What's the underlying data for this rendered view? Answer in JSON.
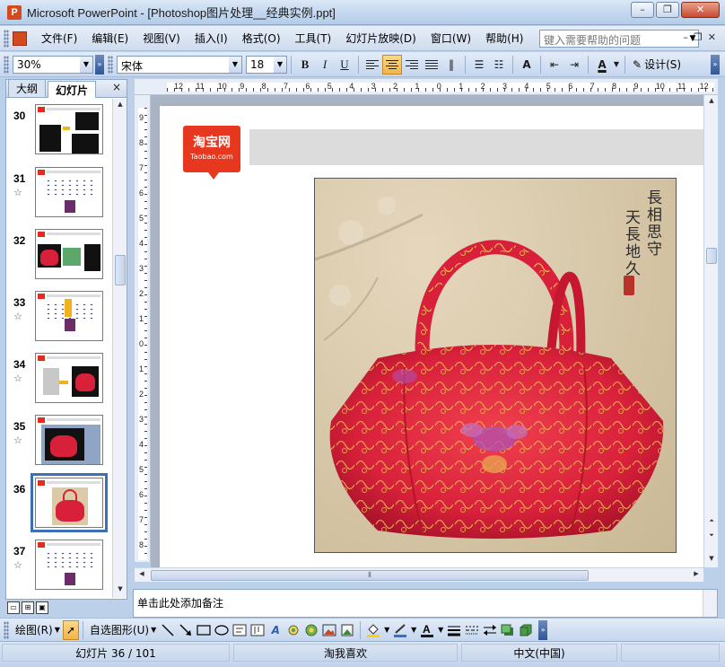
{
  "window": {
    "title": "Microsoft PowerPoint - [Photoshop图片处理__经典实例.ppt]",
    "app_icon_letter": "P",
    "minimize": "–",
    "restore": "❐",
    "close": "✕"
  },
  "menu": {
    "items": [
      "文件(F)",
      "编辑(E)",
      "视图(V)",
      "插入(I)",
      "格式(O)",
      "工具(T)",
      "幻灯片放映(D)",
      "窗口(W)",
      "帮助(H)"
    ],
    "help_placeholder": "键入需要帮助的问题",
    "mdi_minimize": "–",
    "mdi_restore": "❐",
    "mdi_close": "✕"
  },
  "format_toolbar": {
    "zoom": "30%",
    "font": "宋体",
    "size": "18",
    "bold": "B",
    "italic": "I",
    "underline": "U",
    "grow_font": "A",
    "font_color": "A",
    "design": "设计(S)"
  },
  "outline_pane": {
    "tabs": [
      "大纲",
      "幻灯片"
    ],
    "active_tab": "幻灯片",
    "close": "×",
    "slides": [
      {
        "number": "30",
        "star": ""
      },
      {
        "number": "31",
        "star": "☆"
      },
      {
        "number": "32",
        "star": ""
      },
      {
        "number": "33",
        "star": "☆"
      },
      {
        "number": "34",
        "star": "☆"
      },
      {
        "number": "35",
        "star": "☆"
      },
      {
        "number": "36",
        "star": "",
        "selected": true
      },
      {
        "number": "37",
        "star": "☆"
      }
    ]
  },
  "rulers": {
    "horizontal": [
      "12",
      "11",
      "10",
      "9",
      "8",
      "7",
      "6",
      "5",
      "4",
      "3",
      "2",
      "1",
      "0",
      "1",
      "2",
      "3",
      "4",
      "5",
      "6",
      "7",
      "8",
      "9",
      "10",
      "11",
      "12"
    ],
    "vertical": [
      "9",
      "8",
      "7",
      "6",
      "5",
      "4",
      "3",
      "2",
      "1",
      "0",
      "1",
      "2",
      "3",
      "4",
      "5",
      "6",
      "7",
      "8"
    ]
  },
  "slide": {
    "logo_text": "淘宝网",
    "logo_sub": "Taobao.com",
    "poem_line1": "長相思守",
    "poem_line2": "天長地久"
  },
  "notes": {
    "placeholder": "单击此处添加备注"
  },
  "drawing_toolbar": {
    "draw_menu": "绘图(R)",
    "autoshapes": "自选图形(U)"
  },
  "status": {
    "slide_info": "幻灯片 36 / 101",
    "design": "淘我喜欢",
    "language": "中文(中国)"
  },
  "colors": {
    "accent": "#3c6fb4",
    "taobao_red": "#e8371f",
    "bag_red": "#d8203a"
  }
}
